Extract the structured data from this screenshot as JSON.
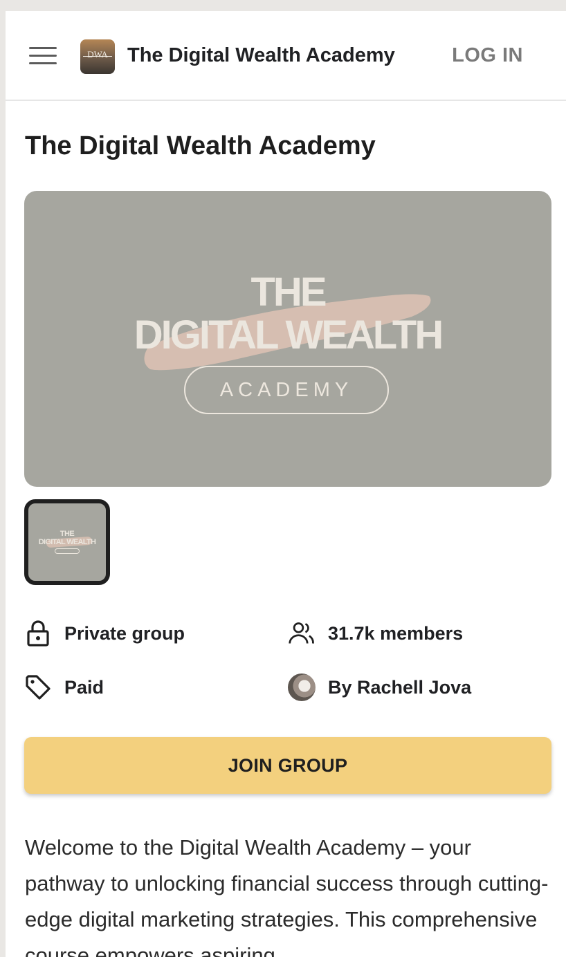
{
  "header": {
    "brand_name": "The Digital Wealth Academy",
    "logo_text": "DWA",
    "login_label": "LOG IN"
  },
  "page_title": "The Digital Wealth Academy",
  "banner": {
    "line1": "THE",
    "line2": "DIGITAL WEALTH",
    "pill": "ACADEMY",
    "background_color": "#a6a69f",
    "brush_color": "#dcc1b3"
  },
  "thumbnail": {
    "line1": "THE",
    "line2": "DIGITAL WEALTH"
  },
  "info": {
    "privacy": {
      "icon": "lock-icon",
      "label": "Private group"
    },
    "members": {
      "icon": "users-icon",
      "label": "31.7k members"
    },
    "pricing": {
      "icon": "tag-icon",
      "label": "Paid"
    },
    "owner": {
      "icon": "avatar",
      "label": "By Rachell Jova"
    }
  },
  "join_button": {
    "label": "JOIN GROUP",
    "color": "#f3d07e"
  },
  "description": "Welcome to the Digital Wealth Academy – your pathway to unlocking financial success through cutting-edge digital marketing strategies. This comprehensive course empowers aspiring"
}
